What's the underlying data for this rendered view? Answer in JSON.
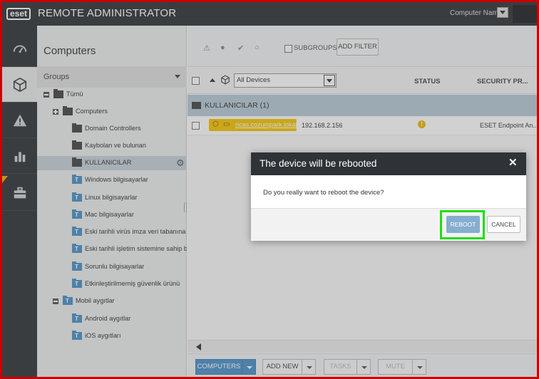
{
  "app": {
    "logo_text": "eset",
    "title": "REMOTE ADMINISTRATOR",
    "computer_name_label": "Computer Name"
  },
  "nav": {
    "items": [
      {
        "icon": "dashboard-icon"
      },
      {
        "icon": "cube-icon",
        "active": true
      },
      {
        "icon": "warning-icon"
      },
      {
        "icon": "bar-chart-icon"
      },
      {
        "icon": "briefcase-icon"
      }
    ]
  },
  "groups_panel": {
    "title": "Computers",
    "header": "Groups",
    "tree": [
      {
        "label": "Tümü",
        "type": "static",
        "expander": "minus"
      },
      {
        "label": "Computers",
        "type": "static",
        "expander": "plus"
      },
      {
        "label": "Domain Controllers",
        "type": "static"
      },
      {
        "label": "Kaybolan ve bulunan",
        "type": "static"
      },
      {
        "label": "KULLANICILAR",
        "type": "static",
        "selected": true
      },
      {
        "label": "Windows bilgisayarlar",
        "type": "dynamic"
      },
      {
        "label": "Linux bilgisayarlar",
        "type": "dynamic"
      },
      {
        "label": "Mac bilgisayarlar",
        "type": "dynamic"
      },
      {
        "label": "Eski tarihli virüs imza veri tabanına sahip b",
        "type": "dynamic"
      },
      {
        "label": "Eski tarihli işletim sistemine sahip bilgisaya",
        "type": "dynamic"
      },
      {
        "label": "Sorunlu bilgisayarlar",
        "type": "dynamic"
      },
      {
        "label": "Etkinleştirilmemiş güvenlik ürünü",
        "type": "dynamic"
      },
      {
        "label": "Mobil aygıtlar",
        "type": "dynamic",
        "expander": "minus"
      },
      {
        "label": "Android aygıtlar",
        "type": "dynamic"
      },
      {
        "label": "iOS aygıtları",
        "type": "dynamic"
      }
    ]
  },
  "toolbar": {
    "subgroups_label": "SUBGROUPS",
    "add_filter_label": "ADD FILTER"
  },
  "table": {
    "device_filter": "All Devices",
    "columns": [
      "STATUS",
      "SECURITY PR..."
    ],
    "group_label": "KULLANICILAR (1)",
    "rows": [
      {
        "name": "ricas.cozumpark.lokal",
        "ip": "192.168.2.156",
        "status_badge": "!",
        "product": "ESET Endpoint An..."
      }
    ]
  },
  "bottom": {
    "computers_label": "COMPUTERS",
    "add_new_label": "ADD NEW",
    "tasks_label": "TASKS",
    "mute_label": "MUTE"
  },
  "modal": {
    "title": "The device will be rebooted",
    "close_glyph": "✕",
    "message": "Do you really want to reboot the device?",
    "reboot_label": "REBOOT",
    "cancel_label": "CANCEL"
  },
  "colors": {
    "dark_bar": "#2f3337",
    "accent_blue": "#4a90c8",
    "device_tag": "#f5c400",
    "highlight": "#22dd11",
    "frame": "#cc0000"
  }
}
